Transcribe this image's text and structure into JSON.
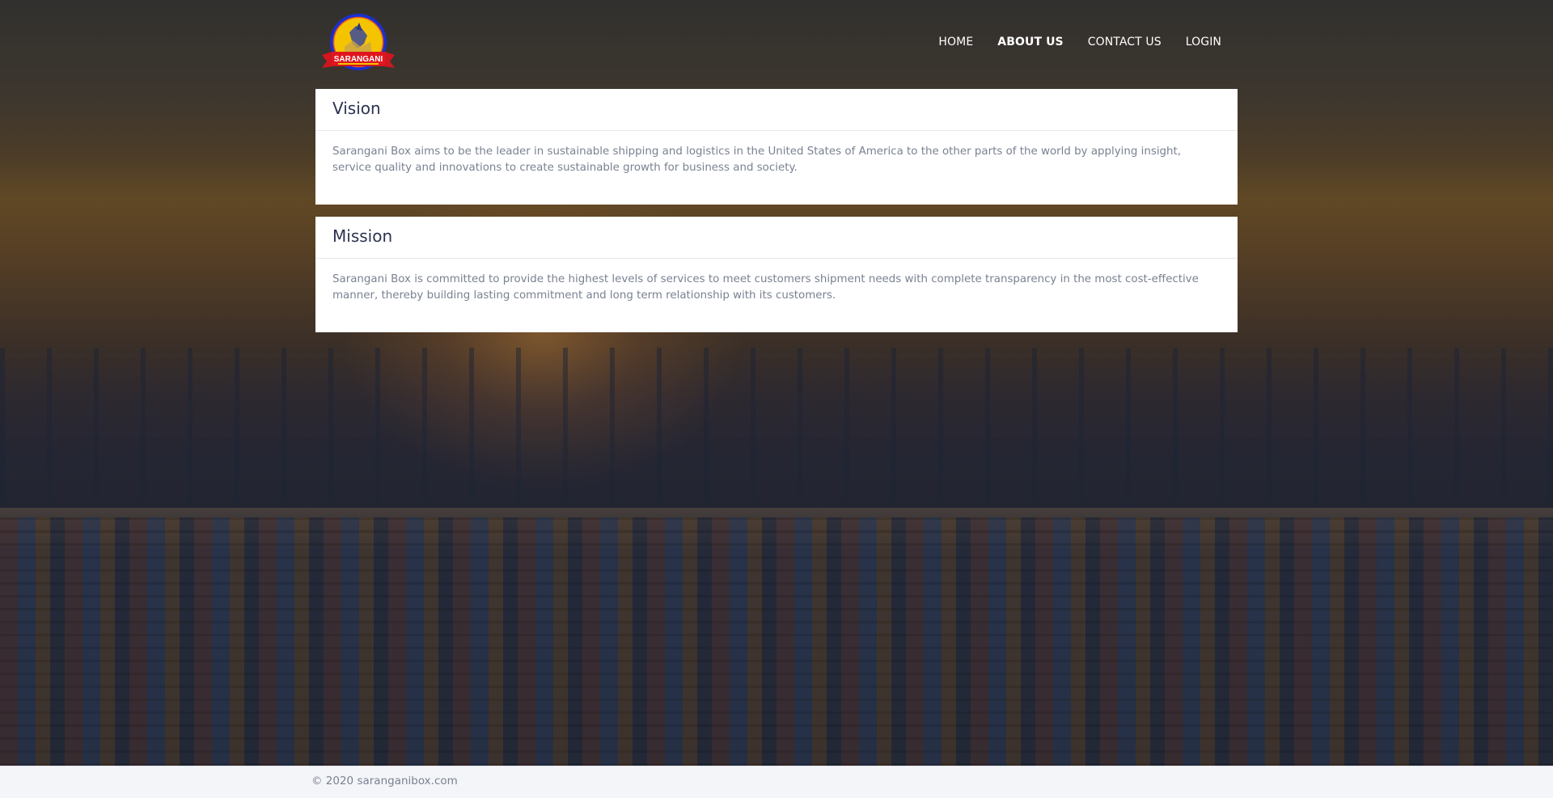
{
  "brand": {
    "logo_text": "SARANGANI",
    "logo_icon": "sarangani-seal-icon",
    "colors": {
      "ring": "#1b2fd0",
      "fill": "#f5c400",
      "ribbon": "#d0161e"
    }
  },
  "nav": {
    "items": [
      {
        "label": "HOME"
      },
      {
        "label": "ABOUT US"
      },
      {
        "label": "CONTACT US"
      },
      {
        "label": "LOGIN"
      }
    ],
    "active": "ABOUT US"
  },
  "vision": {
    "title": "Vision",
    "text": "Sarangani Box aims to be the leader in sustainable shipping and logistics in the United States of America to the other parts of the world by applying insight, service quality and innovations to create sustainable growth for business and society."
  },
  "mission": {
    "title": "Mission",
    "text": "Sarangani Box is committed to provide the highest levels of services to meet customers shipment needs with complete transparency in the most cost-effective manner, thereby building lasting commitment and long term relationship with its customers."
  },
  "footer": {
    "text": "© 2020 saranganibox.com"
  },
  "colors": {
    "panel_title": "#2c3350",
    "body_text": "#7a8192",
    "footer_bg": "#f4f5f8"
  }
}
